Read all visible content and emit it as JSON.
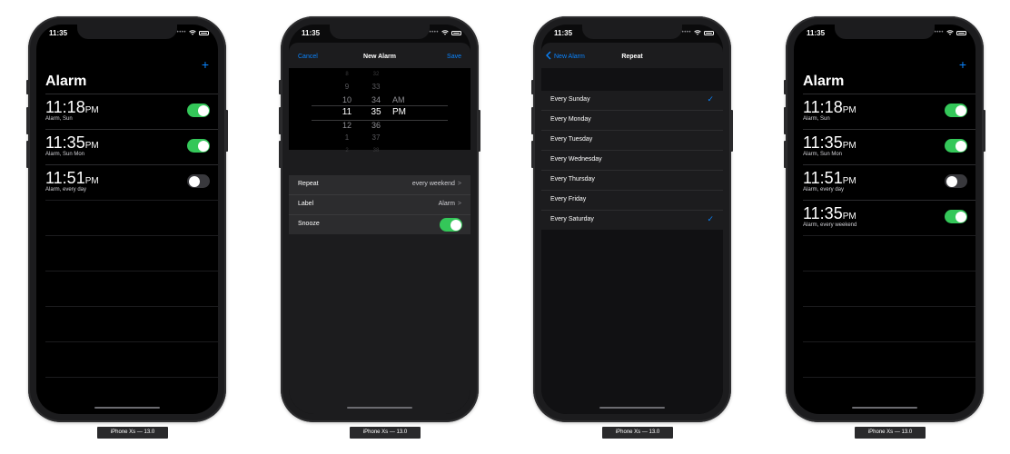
{
  "status": {
    "time": "11:35"
  },
  "device_label": "iPhone Xs — 13.0",
  "screen1": {
    "plus": "+",
    "title": "Alarm",
    "alarms": [
      {
        "time": "11:18",
        "ampm": "PM",
        "subtitle": "Alarm, Sun",
        "enabled": true
      },
      {
        "time": "11:35",
        "ampm": "PM",
        "subtitle": "Alarm, Sun Mon",
        "enabled": true
      },
      {
        "time": "11:51",
        "ampm": "PM",
        "subtitle": "Alarm, every day",
        "enabled": false
      }
    ]
  },
  "screen2": {
    "cancel": "Cancel",
    "title": "New Alarm",
    "save": "Save",
    "picker": {
      "hours": [
        "8",
        "9",
        "10",
        "11",
        "12",
        "1",
        "2"
      ],
      "minutes": [
        "32",
        "33",
        "34",
        "35",
        "36",
        "37",
        "38"
      ],
      "am": "AM",
      "pm": "PM"
    },
    "repeat_label": "Repeat",
    "repeat_value": "every weekend",
    "label_label": "Label",
    "label_value": "Alarm",
    "snooze_label": "Snooze",
    "snooze_on": true,
    "chevron": ">"
  },
  "screen3": {
    "back": "New Alarm",
    "title": "Repeat",
    "days": [
      {
        "label": "Every Sunday",
        "checked": true
      },
      {
        "label": "Every Monday",
        "checked": false
      },
      {
        "label": "Every Tuesday",
        "checked": false
      },
      {
        "label": "Every Wednesday",
        "checked": false
      },
      {
        "label": "Every Thursday",
        "checked": false
      },
      {
        "label": "Every Friday",
        "checked": false
      },
      {
        "label": "Every Saturday",
        "checked": true
      }
    ],
    "checkmark": "✓"
  },
  "screen4": {
    "plus": "+",
    "title": "Alarm",
    "alarms": [
      {
        "time": "11:18",
        "ampm": "PM",
        "subtitle": "Alarm, Sun",
        "enabled": true
      },
      {
        "time": "11:35",
        "ampm": "PM",
        "subtitle": "Alarm, Sun Mon",
        "enabled": true
      },
      {
        "time": "11:51",
        "ampm": "PM",
        "subtitle": "Alarm, every day",
        "enabled": false
      },
      {
        "time": "11:35",
        "ampm": "PM",
        "subtitle": "Alarm, every weekend",
        "enabled": true
      }
    ]
  },
  "colors": {
    "accent": "#0a84ff",
    "toggle_on": "#34c759",
    "toggle_off": "#39393d",
    "background": "#000000"
  }
}
